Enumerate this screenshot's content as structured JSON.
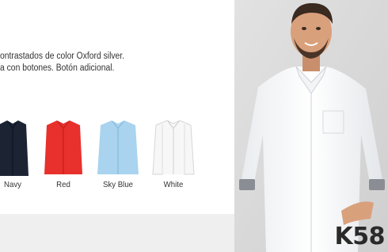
{
  "product": {
    "description_lines": [
      "ontrastados de color Oxford silver.",
      "a con botones. Botón adicional."
    ],
    "reference": "K58"
  },
  "colors": [
    {
      "name": "Navy",
      "hex": "#1c2434"
    },
    {
      "name": "Red",
      "hex": "#e8302c"
    },
    {
      "name": "Sky Blue",
      "hex": "#a9d3ee"
    },
    {
      "name": "White",
      "hex": "#f7f7f7"
    }
  ],
  "theme": {
    "page_background": "#ffffff",
    "band_background": "#efefef",
    "photo_background": "#dadada"
  }
}
